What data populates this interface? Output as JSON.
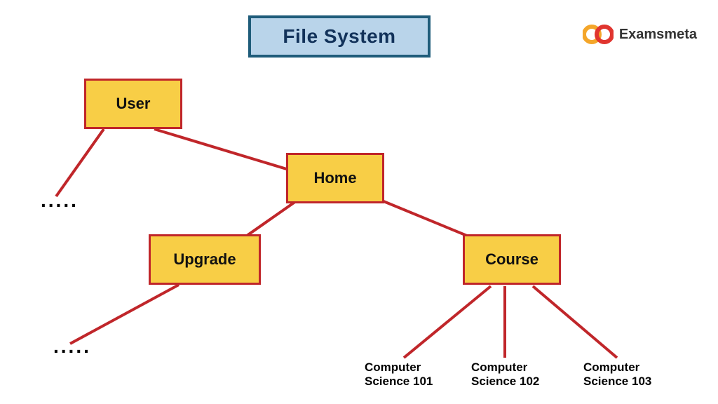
{
  "title": "File System",
  "brand": "Examsmeta",
  "nodes": {
    "user": {
      "label": "User"
    },
    "home": {
      "label": "Home"
    },
    "upgrade": {
      "label": "Upgrade"
    },
    "course": {
      "label": "Course"
    }
  },
  "leaves": {
    "cs101": "Computer Science 101",
    "cs102": "Computer Science 102",
    "cs103": "Computer Science 103"
  },
  "ellipsis": "....."
}
